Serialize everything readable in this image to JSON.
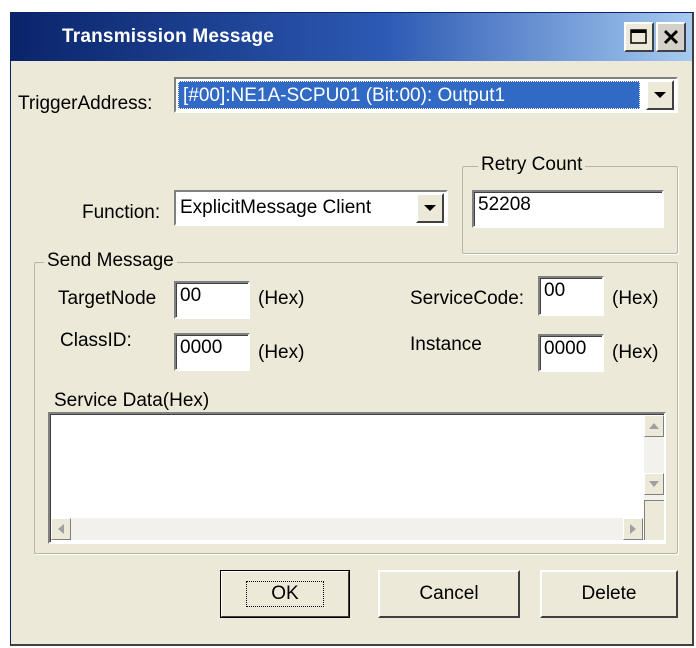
{
  "window": {
    "title": "Transmission Message"
  },
  "trigger": {
    "label": "TriggerAddress:",
    "value": "[#00]:NE1A-SCPU01 (Bit:00): Output1"
  },
  "function": {
    "label": "Function:",
    "value": "ExplicitMessage Client"
  },
  "retry": {
    "group_title": "Retry Count",
    "value": "52208"
  },
  "send_message": {
    "group_title": "Send Message",
    "target_node": {
      "label": "TargetNode",
      "value": "00",
      "unit": "(Hex)"
    },
    "service_code": {
      "label": "ServiceCode:",
      "value": "00",
      "unit": "(Hex)"
    },
    "class_id": {
      "label": "ClassID:",
      "value": "0000",
      "unit": "(Hex)"
    },
    "instance": {
      "label": "Instance",
      "value": "0000",
      "unit": "(Hex)"
    },
    "service_data": {
      "label": "Service Data(Hex)",
      "value": ""
    }
  },
  "buttons": {
    "ok": "OK",
    "cancel": "Cancel",
    "delete": "Delete"
  },
  "colors": {
    "title_bar": "#0a246a",
    "selection": "#316ac5",
    "face": "#ece9d8"
  }
}
